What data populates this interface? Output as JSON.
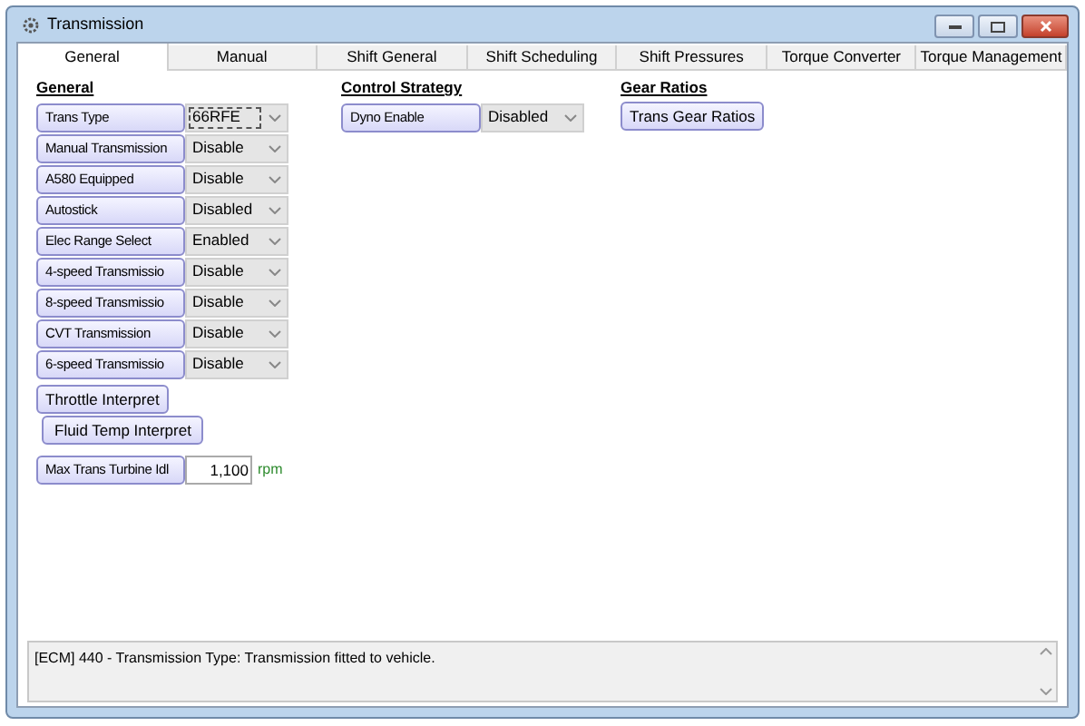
{
  "window": {
    "title": "Transmission"
  },
  "tabs": [
    {
      "label": "General",
      "selected": true
    },
    {
      "label": "Manual",
      "selected": false
    },
    {
      "label": "Shift General",
      "selected": false
    },
    {
      "label": "Shift Scheduling",
      "selected": false
    },
    {
      "label": "Shift Pressures",
      "selected": false
    },
    {
      "label": "Torque Converter",
      "selected": false
    },
    {
      "label": "Torque Management",
      "selected": false
    }
  ],
  "general": {
    "heading": "General",
    "settings": [
      {
        "label": "Trans Type",
        "value": "66RFE",
        "focused": true
      },
      {
        "label": "Manual Transmission",
        "value": "Disable",
        "focused": false
      },
      {
        "label": "A580 Equipped",
        "value": "Disable",
        "focused": false
      },
      {
        "label": "Autostick",
        "value": "Disabled",
        "focused": false
      },
      {
        "label": "Elec Range Select",
        "value": "Enabled",
        "focused": false
      },
      {
        "label": "4-speed Transmissio",
        "value": "Disable",
        "focused": false
      },
      {
        "label": "8-speed Transmissio",
        "value": "Disable",
        "focused": false
      },
      {
        "label": "CVT Transmission",
        "value": "Disable",
        "focused": false
      },
      {
        "label": "6-speed Transmissio",
        "value": "Disable",
        "focused": false
      }
    ],
    "buttons": [
      "Throttle Interpret",
      "Fluid Temp Interpret"
    ],
    "numeric": {
      "label": "Max Trans Turbine Idl",
      "value": "1,100",
      "unit": "rpm"
    }
  },
  "control_strategy": {
    "heading": "Control Strategy",
    "settings": [
      {
        "label": "Dyno Enable",
        "value": "Disabled",
        "focused": false
      }
    ]
  },
  "gear_ratios": {
    "heading": "Gear Ratios",
    "buttons": [
      "Trans Gear Ratios"
    ]
  },
  "status": {
    "message": "[ECM] 440 - Transmission Type: Transmission fitted to vehicle."
  }
}
